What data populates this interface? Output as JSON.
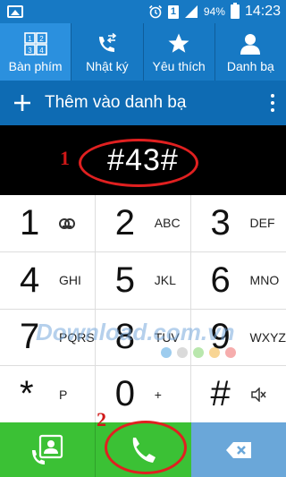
{
  "status_bar": {
    "battery": "94%",
    "time": "14:23",
    "sim": "1"
  },
  "tabs": [
    {
      "label": "Bàn phím",
      "icon": "keypad-icon"
    },
    {
      "label": "Nhật ký",
      "icon": "call-log-icon"
    },
    {
      "label": "Yêu thích",
      "icon": "star-icon"
    },
    {
      "label": "Danh bạ",
      "icon": "contacts-icon"
    }
  ],
  "action_bar": {
    "add_label": "Thêm vào danh bạ"
  },
  "display": {
    "number": "#43#"
  },
  "annotations": {
    "one": "1",
    "two": "2"
  },
  "keys": [
    {
      "digit": "1",
      "letters": ""
    },
    {
      "digit": "2",
      "letters": "ABC"
    },
    {
      "digit": "3",
      "letters": "DEF"
    },
    {
      "digit": "4",
      "letters": "GHI"
    },
    {
      "digit": "5",
      "letters": "JKL"
    },
    {
      "digit": "6",
      "letters": "MNO"
    },
    {
      "digit": "7",
      "letters": "PQRS"
    },
    {
      "digit": "8",
      "letters": "TUV"
    },
    {
      "digit": "9",
      "letters": "WXYZ"
    },
    {
      "digit": "*",
      "letters": "P"
    },
    {
      "digit": "0",
      "letters": "+"
    },
    {
      "digit": "#",
      "letters": ""
    }
  ],
  "watermark": {
    "text": "Download.com.vn"
  },
  "colors": {
    "header": "#1779c4",
    "call_green": "#3bc135",
    "delete_blue": "#6aa7d9",
    "annotation_red": "#e02020"
  }
}
